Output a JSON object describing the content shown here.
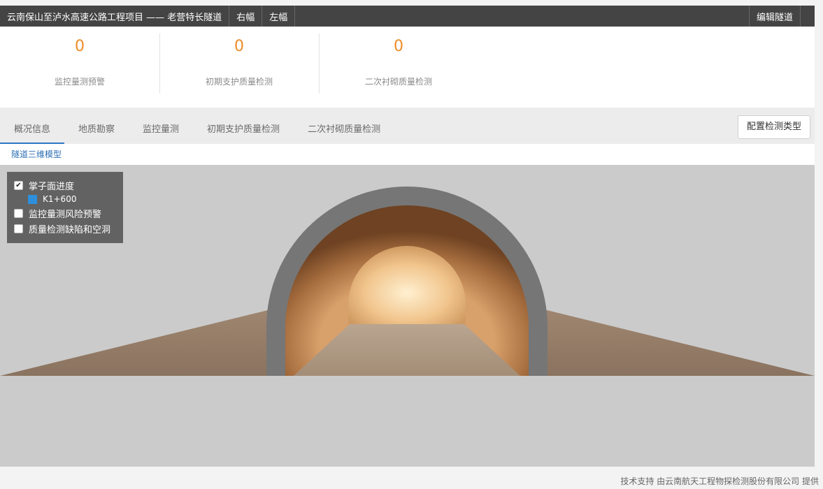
{
  "header": {
    "title": "云南保山至泸水高速公路工程项目 —— 老营特长隧道",
    "segments": [
      "右幅",
      "左幅"
    ],
    "edit_label": "编辑隧道"
  },
  "stats": [
    {
      "value": "0",
      "label": "监控量测预警"
    },
    {
      "value": "0",
      "label": "初期支护质量检测"
    },
    {
      "value": "0",
      "label": "二次衬砌质量检测"
    }
  ],
  "tabs": [
    {
      "label": "概况信息",
      "active": true
    },
    {
      "label": "地质勘察",
      "active": false
    },
    {
      "label": "监控量测",
      "active": false
    },
    {
      "label": "初期支护质量检测",
      "active": false
    },
    {
      "label": "二次衬砌质量检测",
      "active": false
    }
  ],
  "config_button": "配置检测类型",
  "subnav": {
    "label": "隧道三维模型"
  },
  "layers": {
    "items": [
      {
        "label": "掌子面进度",
        "checked": true
      },
      {
        "label": "监控量测风险预警",
        "checked": false
      },
      {
        "label": "质量检测缺陷和空洞",
        "checked": false
      }
    ],
    "legend": {
      "label": "K1+600",
      "color": "#2e8fdc"
    }
  },
  "footer": {
    "text": "技术支持 由云南航天工程物探检测股份有限公司 提供"
  },
  "colors": {
    "accent": "#ef8c28",
    "tab_active": "#2d78c4",
    "topbar": "#444444"
  }
}
